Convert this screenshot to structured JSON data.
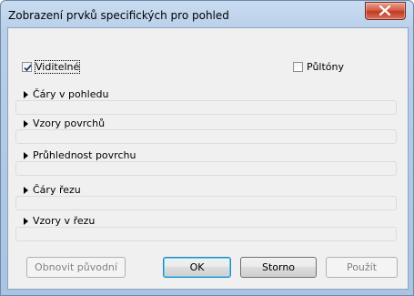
{
  "window": {
    "title": "Zobrazení prvků specifických pro pohled"
  },
  "options": {
    "visible_label": "Viditelné",
    "visible_checked": true,
    "halftone_label": "Půltóny",
    "halftone_checked": false
  },
  "sections": [
    {
      "label": "Čáry v pohledu"
    },
    {
      "label": "Vzory povrchů"
    },
    {
      "label": "Průhlednost povrchu"
    },
    {
      "label": "Čáry řezu"
    },
    {
      "label": "Vzory v řezu"
    }
  ],
  "buttons": {
    "restore_label": "Obnovit původní",
    "ok_label": "OK",
    "cancel_label": "Storno",
    "apply_label": "Použít"
  }
}
